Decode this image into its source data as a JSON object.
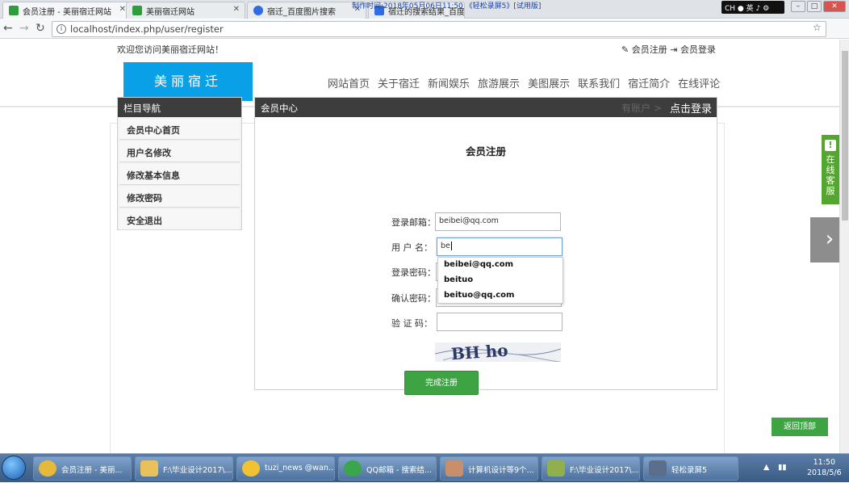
{
  "browser": {
    "tabs": [
      {
        "title": "会员注册 - 美丽宿迁网站",
        "active": true,
        "color": "#2e9e3c"
      },
      {
        "title": "美丽宿迁网站",
        "active": false,
        "color": "#2e9e3c"
      },
      {
        "title": "宿迁_百度图片搜索",
        "active": false,
        "color": "#2f6de0"
      },
      {
        "title": "宿迁的搜索结果_百度图片",
        "active": false,
        "color": "#2f6de0"
      }
    ],
    "recording_banner": "制作时间:2018年05月06日11:50 《轻松录屏5》[试用版]",
    "ime": "CH",
    "url": "localhost/index.php/user/register"
  },
  "site": {
    "welcome": "欢迎您访问美丽宿迁网站！",
    "top_links": {
      "register": "会员注册",
      "login": "会员登录"
    },
    "logo_text": "美丽宿迁",
    "nav": [
      "网站首页",
      "关于宿迁",
      "新闻娱乐",
      "旅游展示",
      "美图展示",
      "联系我们",
      "宿迁简介",
      "在线评论"
    ]
  },
  "sidebar": {
    "header": "栏目导航",
    "items": [
      "会员中心首页",
      "用户名修改",
      "修改基本信息",
      "修改密码",
      "安全退出"
    ]
  },
  "panel": {
    "header": "会员中心",
    "has_account": "有账户 >",
    "login_link": "点击登录",
    "form_title": "会员注册",
    "fields": {
      "email_label": "登录邮箱：",
      "email_value": "beibei@qq.com",
      "username_label": "用 户 名：",
      "username_value": "be",
      "password_label": "登录密码：",
      "confirm_label": "确认密码：",
      "captcha_label": "验 证 码："
    },
    "autocomplete": [
      "beibei@qq.com",
      "beituo",
      "beituo@qq.com"
    ],
    "captcha_text": "BH ho",
    "submit": "完成注册"
  },
  "floating": {
    "service": [
      "在",
      "线",
      "客",
      "服"
    ],
    "next_arrow": "›",
    "back_to_top": "返回顶部"
  },
  "taskbar": {
    "items": [
      {
        "label": "会员注册 - 美丽...",
        "color": "#e7b93a"
      },
      {
        "label": "F:\\毕业设计2017\\...",
        "color": "#e9c15a"
      },
      {
        "label": "tuzi_news @wan...",
        "color": "#f1c232"
      },
      {
        "label": "QQ邮箱 - 搜索结...",
        "color": "#3aa54a"
      },
      {
        "label": "计算机设计等9个...",
        "color": "#c98f6a"
      },
      {
        "label": "F:\\毕业设计2017\\...",
        "color": "#8fb04a"
      },
      {
        "label": "轻松录屏5",
        "color": "#5b6f8d"
      }
    ],
    "time": "11:50",
    "date": "2018/5/6"
  }
}
